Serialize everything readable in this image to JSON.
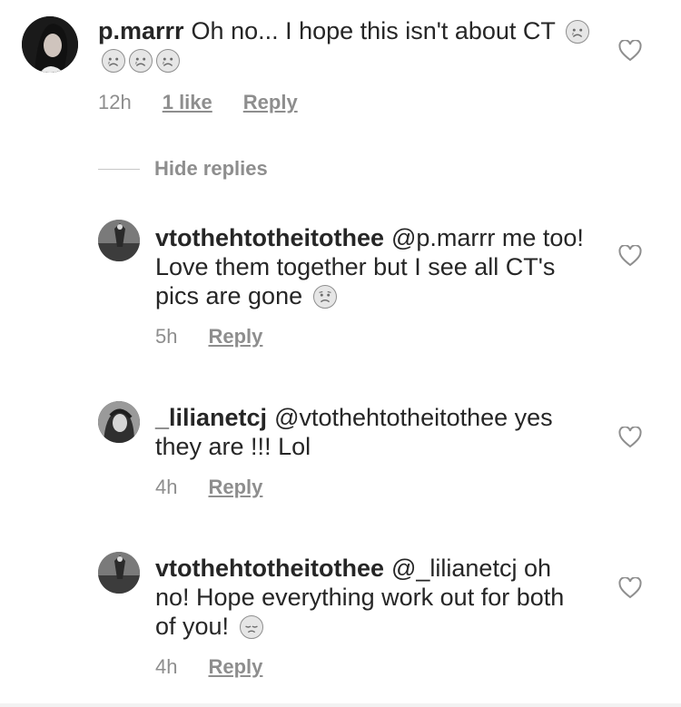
{
  "comments": [
    {
      "username": "p.marrr",
      "text": "Oh no... I hope this isn't about CT",
      "emoji": [
        "crying-face",
        "crying-face",
        "crying-face",
        "crying-face"
      ],
      "time": "12h",
      "likes": "1 like",
      "reply_label": "Reply"
    }
  ],
  "hide_replies_label": "Hide replies",
  "replies": [
    {
      "username": "vtothehtotheitothee",
      "text": "@p.marrr me too! Love them together but I see all CT's pics are gone",
      "emoji": [
        "worried-face"
      ],
      "time": "5h",
      "reply_label": "Reply"
    },
    {
      "username": "_lilianetcj",
      "text": "@vtothehtotheitothee yes they are !!! Lol",
      "emoji": [],
      "time": "4h",
      "reply_label": "Reply"
    },
    {
      "username": "vtothehtotheitothee",
      "text": "@_lilianetcj oh no! Hope everything work out for both of you!",
      "emoji": [
        "disappointed-face"
      ],
      "time": "4h",
      "reply_label": "Reply"
    }
  ],
  "icons": {
    "like": "heart-icon",
    "avatar": "avatar"
  },
  "colors": {
    "text": "#262626",
    "secondary": "#8e8e8e"
  }
}
